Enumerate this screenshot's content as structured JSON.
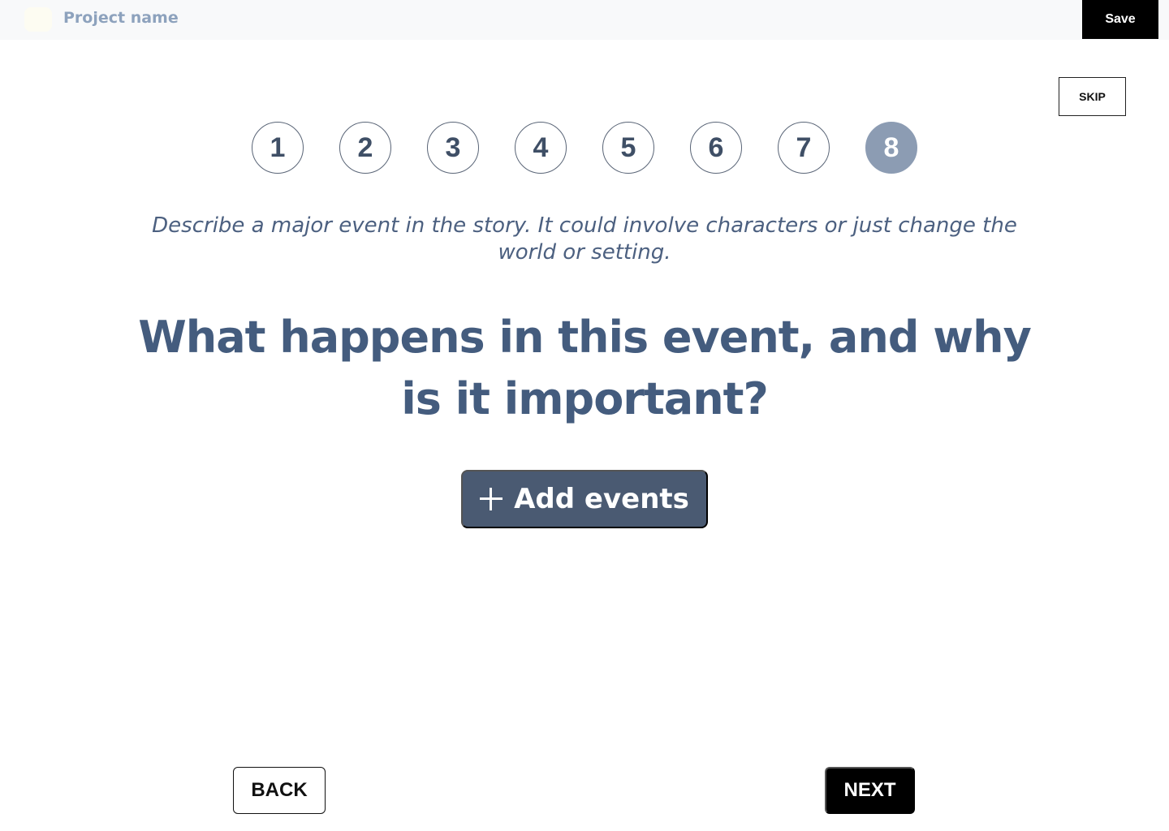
{
  "header": {
    "project_name": "Project name",
    "save_label": "Save"
  },
  "skip_label": "SKIP",
  "steps": {
    "items": [
      "1",
      "2",
      "3",
      "4",
      "5",
      "6",
      "7",
      "8"
    ],
    "active": "8"
  },
  "prompt": {
    "description": "Describe a major event in the story. It could involve characters or just change the world or setting.",
    "question": "What happens in this event, and why is it important?"
  },
  "add_events": {
    "label": "Add events",
    "icon": "plus-icon"
  },
  "nav": {
    "back_label": "BACK",
    "next_label": "NEXT"
  },
  "colors": {
    "header_bg": "#f8f9fa",
    "project_name": "#8da2bd",
    "heading": "#445c7e",
    "active_step": "#8c9cb3",
    "add_button_bg": "#4a5a72",
    "primary_black": "#000000"
  }
}
